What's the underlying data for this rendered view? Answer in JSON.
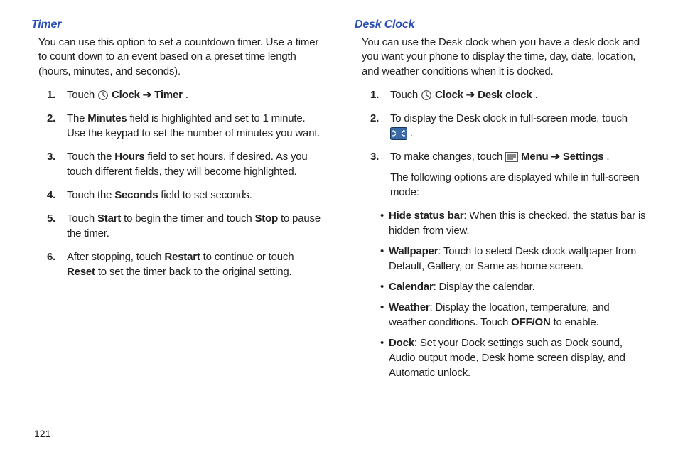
{
  "pageNumber": "121",
  "left": {
    "heading": "Timer",
    "intro": "You can use this option to set a countdown timer. Use a timer to count down to an event based on a preset time length (hours, minutes, and seconds).",
    "steps": [
      {
        "num": "1.",
        "pre": "Touch ",
        "b1": "Clock",
        "arrow": " ➔ ",
        "b2": "Timer",
        "post": ".",
        "icon": "clock"
      },
      {
        "num": "2.",
        "pre": "The ",
        "b1": "Minutes",
        "mid": " field is highlighted and set to 1 minute. Use the keypad to set the number of minutes you want."
      },
      {
        "num": "3.",
        "pre": "Touch the ",
        "b1": "Hours",
        "mid": " field to set hours, if desired. As you touch different fields, they will become highlighted."
      },
      {
        "num": "4.",
        "pre": "Touch the ",
        "b1": "Seconds",
        "mid": " field to set seconds."
      },
      {
        "num": "5.",
        "pre": "Touch ",
        "b1": "Start",
        "mid": " to begin the timer and touch ",
        "b2": "Stop",
        "post": " to pause the timer."
      },
      {
        "num": "6.",
        "pre": "After stopping, touch ",
        "b1": "Restart",
        "mid": " to continue or touch ",
        "b2": "Reset",
        "post": " to set the timer back to the original setting."
      }
    ]
  },
  "right": {
    "heading": "Desk Clock",
    "intro": "You can use the Desk clock when you have a desk dock and you want your phone to display the time, day, date, location, and weather conditions when it is docked.",
    "step1": {
      "num": "1.",
      "pre": "Touch ",
      "b1": "Clock",
      "arrow": " ➔  ",
      "b2": "Desk clock",
      "post": "."
    },
    "step2": {
      "num": "2.",
      "pre": "To display the Desk clock in full-screen mode, touch ",
      "post": "."
    },
    "step3": {
      "num": "3.",
      "pre": "To make changes, touch ",
      "b1": "Menu",
      "arrow": " ➔ ",
      "b2": "Settings",
      "post": ".",
      "tail": "The following options are displayed while in full-screen mode:"
    },
    "bullets": [
      {
        "b": "Hide status bar",
        "text": ": When this is checked, the status bar is hidden from view."
      },
      {
        "b": "Wallpaper",
        "text": ": Touch to select Desk clock wallpaper from Default, Gallery, or Same as home screen."
      },
      {
        "b": "Calendar",
        "text": ": Display the calendar."
      },
      {
        "b": "Weather",
        "pre": ": Display the location, temperature, and weather conditions. Touch ",
        "b2": "OFF/ON",
        "post": " to enable."
      },
      {
        "b": "Dock",
        "text": ": Set your Dock settings such as Dock sound, Audio output mode, Desk home screen display, and Automatic unlock."
      }
    ]
  }
}
